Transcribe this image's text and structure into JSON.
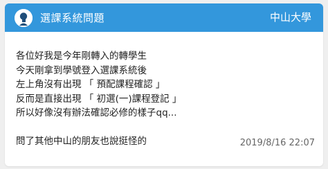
{
  "header": {
    "title": "選課系統問題",
    "board": "中山大學",
    "avatar_icon": "user-avatar-icon",
    "accent_color": "#3397dc"
  },
  "post": {
    "lines": [
      "各位好我是今年剛轉入的轉學生",
      "今天剛拿到學號登入選課系統後",
      "左上角沒有出現 「 預配課程確認 」",
      "反而是直接出現 「 初選(一)課程登記 」",
      "所以好像沒有辦法確認必修的樣子qq...",
      "",
      "問了其他中山的朋友也說挺怪的"
    ],
    "timestamp": "2019/8/16 22:07"
  }
}
